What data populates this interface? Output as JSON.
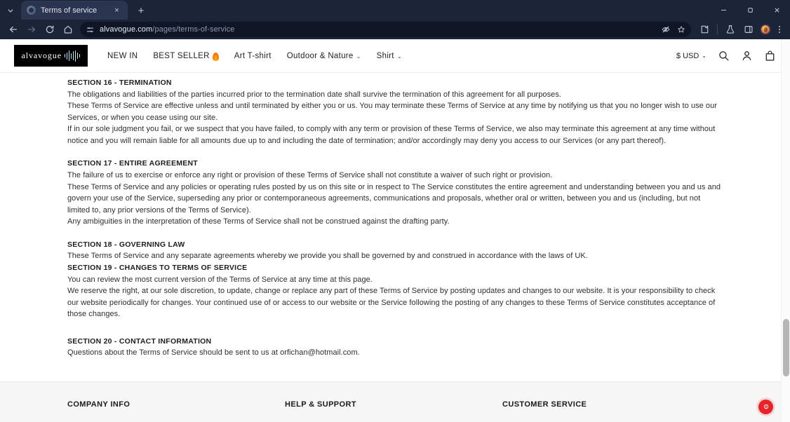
{
  "browser": {
    "tab": {
      "title": "Terms of service",
      "favicon": "globe-icon",
      "close": "×"
    },
    "new_tab_label": "+",
    "address": {
      "domain": "alvavogue.com",
      "path": "/pages/terms-of-service"
    },
    "window_controls": {
      "minimize": "—",
      "maximize": "□",
      "close": "✕"
    }
  },
  "site": {
    "logo_text": "alvavogue",
    "nav": [
      {
        "label": "NEW IN",
        "caret": false,
        "badge": false
      },
      {
        "label": "BEST SELLER",
        "caret": false,
        "badge": true
      },
      {
        "label": "Art T-shirt",
        "caret": false,
        "badge": false
      },
      {
        "label": "Outdoor & Nature",
        "caret": true,
        "badge": false
      },
      {
        "label": "Shirt",
        "caret": true,
        "badge": false
      }
    ],
    "currency": "$ USD",
    "caret": "⌄"
  },
  "content": {
    "sections": [
      {
        "title": "SECTION 16 - TERMINATION",
        "paragraphs": [
          "The obligations and liabilities of the parties incurred prior to the termination date shall survive the termination of this agreement for all purposes.",
          "These Terms of Service are effective unless and until terminated by either you or us. You may terminate these Terms of Service at any time by notifying us that you no longer wish to use our Services, or when you cease using our site.",
          "If in our sole judgment you fail, or we suspect that you have failed, to comply with any term or provision of these Terms of Service, we also may terminate this agreement at any time without notice and you will remain liable for all amounts due up to and including the date of termination; and/or accordingly may deny you access to our Services (or any part thereof)."
        ]
      },
      {
        "title": "SECTION 17 - ENTIRE AGREEMENT",
        "paragraphs": [
          "The failure of us to exercise or enforce any right or provision of these Terms of Service shall not constitute a waiver of such right or provision.",
          "These Terms of Service and any policies or operating rules posted by us on this site or in respect to The Service constitutes the entire agreement and understanding between you and us and govern your use of the Service, superseding any prior or contemporaneous agreements, communications and proposals, whether oral or written, between you and us (including, but not limited to, any prior versions of the Terms of Service).",
          "Any ambiguities in the interpretation of these Terms of Service shall not be construed against the drafting party."
        ]
      },
      {
        "title": "SECTION 18 - GOVERNING LAW",
        "paragraphs": [
          "These Terms of Service and any separate agreements whereby we provide you shall be governed by and construed in accordance with the laws of UK."
        ]
      },
      {
        "title": "SECTION 19 - CHANGES TO TERMS OF SERVICE",
        "paragraphs": [
          "You can review the most current version of the Terms of Service at any time at this page.",
          "We reserve the right, at our sole discretion, to update, change or replace any part of these Terms of Service by posting updates and changes to our website. It is your responsibility to check our website periodically for changes. Your continued use of or access to our website or the Service following the posting of any changes to these Terms of Service constitutes acceptance of those changes."
        ]
      },
      {
        "title": "SECTION 20 - CONTACT INFORMATION",
        "paragraphs": [
          "Questions about the Terms of Service should be sent to us at orfichan@hotmail.com."
        ]
      }
    ]
  },
  "footer": {
    "columns": [
      {
        "title": "COMPANY INFO"
      },
      {
        "title": "HELP & SUPPORT"
      },
      {
        "title": "CUSTOMER SERVICE"
      }
    ]
  },
  "colors": {
    "chrome_bg": "#1c2538",
    "tab_active": "#2b3550",
    "omnibox_bg": "#101625",
    "fab_red": "#e8232a",
    "footer_bg": "#f6f6f6"
  }
}
